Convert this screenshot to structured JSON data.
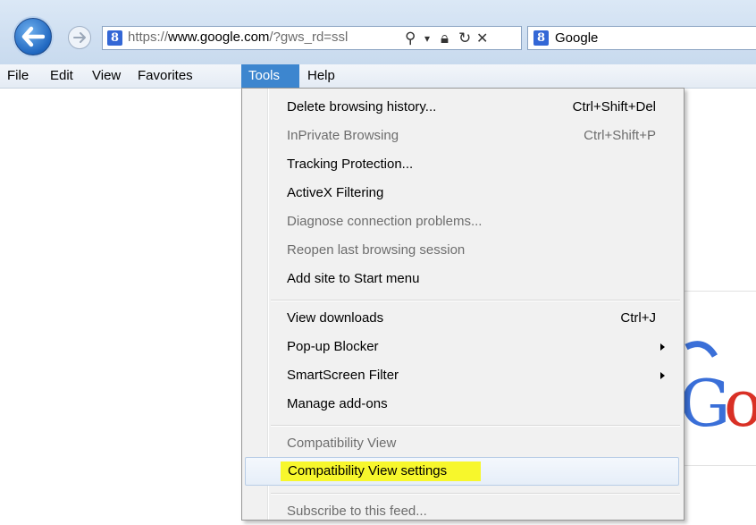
{
  "address_bar": {
    "favicon_letter": "8",
    "url_scheme": "https://",
    "url_host": "www.google.com",
    "url_rest": "/?gws_rd=ssl"
  },
  "tab": {
    "favicon_letter": "8",
    "title": "Google"
  },
  "menubar": {
    "items": [
      {
        "label": "File"
      },
      {
        "label": "Edit"
      },
      {
        "label": "View"
      },
      {
        "label": "Favorites"
      },
      {
        "label": "Tools"
      },
      {
        "label": "Help"
      }
    ],
    "active": "Tools"
  },
  "tools_menu": {
    "items": [
      {
        "label": "Delete browsing history...",
        "shortcut": "Ctrl+Shift+Del",
        "enabled": true
      },
      {
        "label": "InPrivate Browsing",
        "shortcut": "Ctrl+Shift+P",
        "enabled": false
      },
      {
        "label": "Tracking Protection...",
        "enabled": true
      },
      {
        "label": "ActiveX Filtering",
        "enabled": true
      },
      {
        "label": "Diagnose connection problems...",
        "enabled": false
      },
      {
        "label": "Reopen last browsing session",
        "enabled": false
      },
      {
        "label": "Add site to Start menu",
        "enabled": true
      },
      {
        "label": "View downloads",
        "shortcut": "Ctrl+J",
        "enabled": true
      },
      {
        "label": "Pop-up Blocker",
        "submenu": true,
        "enabled": true
      },
      {
        "label": "SmartScreen Filter",
        "submenu": true,
        "enabled": true
      },
      {
        "label": "Manage add-ons",
        "enabled": true
      },
      {
        "label": "Compatibility View",
        "enabled": false
      },
      {
        "label": "Compatibility View settings",
        "enabled": true,
        "highlighted": true
      },
      {
        "label": "Subscribe to this feed...",
        "enabled": false
      }
    ]
  },
  "colors": {
    "menu_active_bg": "#3d86cf",
    "highlighter": "#f7f72c",
    "disabled_text": "#6d6d6d"
  }
}
